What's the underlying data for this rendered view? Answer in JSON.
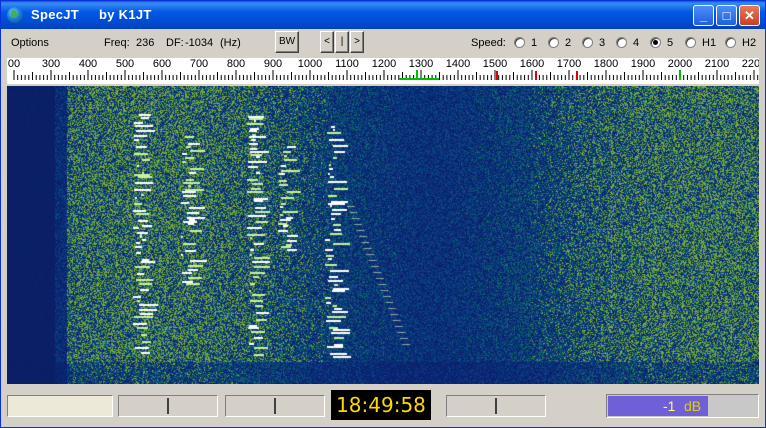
{
  "window": {
    "title": "SpecJT",
    "subtitle": "by K1JT",
    "minimize_label": "_",
    "maximize_label": "□",
    "close_label": "✕"
  },
  "toolbar": {
    "options_label": "Options",
    "freq_label": "Freq:",
    "freq_value": "236",
    "df_label": "DF:",
    "df_value": "-1034",
    "df_unit": "(Hz)",
    "bw_label": "BW",
    "nav_left": "<",
    "nav_center": "|",
    "nav_right": ">",
    "speed_label": "Speed:",
    "speed_options": [
      "1",
      "2",
      "3",
      "4",
      "5",
      "H1",
      "H2"
    ],
    "speed_selected": "5"
  },
  "scale": {
    "ticks": [
      "00",
      "300",
      "400",
      "500",
      "600",
      "700",
      "800",
      "900",
      "1000",
      "1100",
      "1200",
      "1300",
      "1400",
      "1500",
      "1600",
      "1700",
      "1800",
      "1900",
      "2000",
      "2100",
      "2200"
    ]
  },
  "status": {
    "clock": "18:49:58",
    "level_value": "-1",
    "level_unit": "dB"
  },
  "colors": {
    "titlebar": "#0058e6",
    "waterfall_bg": "#0b1f63",
    "clock_text": "#ffd800",
    "marker_green": "#00c000",
    "marker_red": "#e00000"
  }
}
